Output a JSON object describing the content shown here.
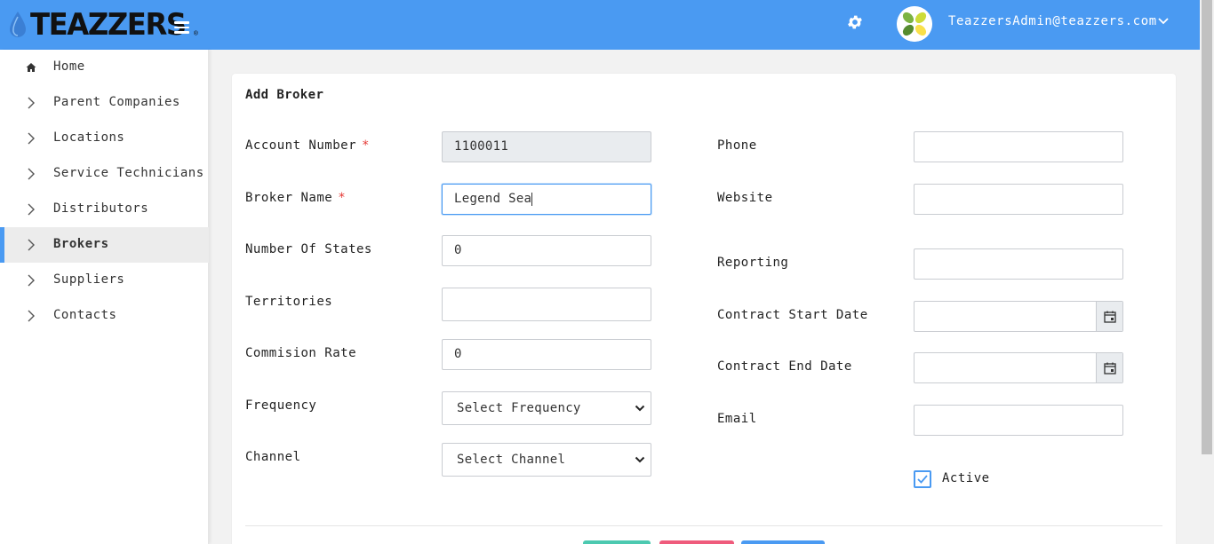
{
  "header": {
    "logo_text": "TEAZZERS",
    "logo_reg": "®",
    "user_email": "TeazzersAdmin@teazzers.com",
    "icons": [
      "menu-icon",
      "gear-icon",
      "chevron-down-icon"
    ]
  },
  "sidebar": {
    "items": [
      {
        "label": "Home",
        "icon": "home-icon"
      },
      {
        "label": "Parent Companies",
        "icon": "chevron-right-icon"
      },
      {
        "label": "Locations",
        "icon": "chevron-right-icon"
      },
      {
        "label": "Service Technicians",
        "icon": "chevron-right-icon"
      },
      {
        "label": "Distributors",
        "icon": "chevron-right-icon"
      },
      {
        "label": "Brokers",
        "icon": "chevron-right-icon",
        "active": true
      },
      {
        "label": "Suppliers",
        "icon": "chevron-right-icon"
      },
      {
        "label": "Contacts",
        "icon": "chevron-right-icon"
      }
    ]
  },
  "form": {
    "title": "Add Broker",
    "required_mark": "*",
    "left": {
      "account_number": {
        "label": "Account Number",
        "value": "1100011"
      },
      "broker_name": {
        "label": "Broker Name",
        "value": "Legend Sea"
      },
      "number_of_states": {
        "label": "Number Of States",
        "value": "0"
      },
      "territories": {
        "label": "Territories",
        "value": ""
      },
      "commision_rate": {
        "label": "Commision Rate",
        "value": "0"
      },
      "frequency": {
        "label": "Frequency",
        "value": "Select Frequency"
      },
      "channel": {
        "label": "Channel",
        "value": "Select Channel"
      }
    },
    "right": {
      "phone": {
        "label": "Phone",
        "value": ""
      },
      "website": {
        "label": "Website",
        "value": ""
      },
      "reporting": {
        "label": "Reporting",
        "value": ""
      },
      "contract_start_date": {
        "label": "Contract Start Date",
        "value": ""
      },
      "contract_end_date": {
        "label": "Contract End Date",
        "value": ""
      },
      "email": {
        "label": "Email",
        "value": ""
      },
      "active": {
        "label": "Active",
        "checked": true
      }
    }
  },
  "colors": {
    "accent": "#4a9af2",
    "required": "#e53935",
    "button_green": "#4cc9b0",
    "button_red": "#ef5b7c",
    "button_blue": "#4a9af2"
  }
}
